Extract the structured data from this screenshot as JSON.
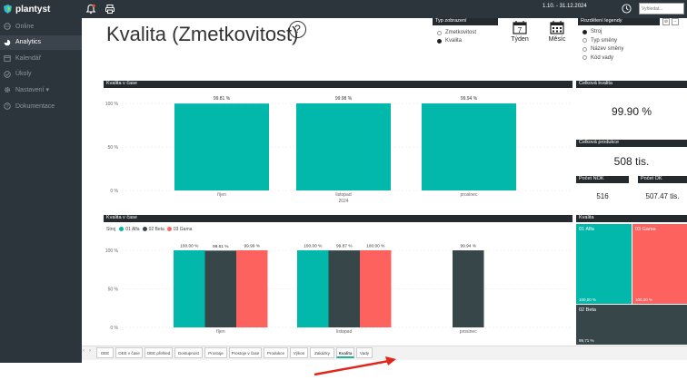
{
  "app": {
    "name": "plantyst"
  },
  "sidebar": {
    "items": [
      {
        "label": "Online",
        "icon": "globe-icon",
        "active": false
      },
      {
        "label": "Analytics",
        "icon": "analytics-icon",
        "active": true
      },
      {
        "label": "Kalendář",
        "icon": "calendar-icon",
        "active": false
      },
      {
        "label": "Úkoly",
        "icon": "check-icon",
        "active": false
      },
      {
        "label": "Nastavení ▾",
        "icon": "gear-icon",
        "active": false
      },
      {
        "label": "Dokumentace",
        "icon": "help-icon",
        "active": false
      }
    ]
  },
  "topbar": {
    "date_range": "1.10. - 31.12.2024",
    "search_placeholder": "Vyhledat..."
  },
  "page": {
    "title": "Kvalita (Zmetkovitost)",
    "help": "?"
  },
  "type_view": {
    "header": "Typ zobrazení",
    "options": [
      "Zmetkovitost",
      "Kvalita"
    ],
    "selected": "Kvalita"
  },
  "period_buttons": {
    "week": "Týden",
    "month": "Měsíc",
    "week_day": "7"
  },
  "legend_split": {
    "header": "Rozdělení legendy",
    "options": [
      "Stroj",
      "Typ směny",
      "Název směny",
      "Kód vady"
    ],
    "selected": "Stroj"
  },
  "cards": {
    "total_quality": {
      "label": "Celková kvalita",
      "value": "99.90 %"
    },
    "total_production": {
      "label": "Celková produkce",
      "value": "508 tis."
    },
    "nok": {
      "label": "Počet NOK",
      "value": "516"
    },
    "ok": {
      "label": "Počet OK",
      "value": "507.47 tis."
    }
  },
  "colors": {
    "teal": "#01b8aa",
    "dark": "#374649",
    "red": "#fd625e",
    "header": "#252a2e",
    "sidebar": "#2d353c"
  },
  "chart_data": [
    {
      "type": "bar",
      "title": "Kvalita v čase",
      "categories": [
        "říjen",
        "listopad",
        "prosinec"
      ],
      "xlabel": "2024",
      "values": [
        99.81,
        99.98,
        99.94
      ],
      "labels": [
        "99.81 %",
        "99.98 %",
        "99.94 %"
      ],
      "ylim": [
        0,
        100
      ],
      "yticks": [
        "100 %",
        "50 %",
        "0 %"
      ]
    },
    {
      "type": "bar",
      "title": "Kvalita v čase",
      "legend_title": "Stroj",
      "categories": [
        "říjen",
        "listopad",
        "prosinec"
      ],
      "series": [
        {
          "name": "01 Alfa",
          "color": "#01b8aa",
          "values": [
            100.0,
            100.0,
            null
          ],
          "labels": [
            "100.00 %",
            "100.00 %",
            ""
          ]
        },
        {
          "name": "02 Beta",
          "color": "#374649",
          "values": [
            99.61,
            99.87,
            99.94
          ],
          "labels": [
            "99.61 %",
            "99.87 %",
            "99.94 %"
          ]
        },
        {
          "name": "03 Gama",
          "color": "#fd625e",
          "values": [
            99.99,
            100.0,
            null
          ],
          "labels": [
            "99.99 %",
            "100.00 %",
            ""
          ]
        }
      ],
      "ylim": [
        0,
        100
      ],
      "yticks": [
        "100 %",
        "50 %",
        "0 %"
      ]
    }
  ],
  "treemap": {
    "title": "Kvalita",
    "cells": [
      {
        "name": "01 Alfa",
        "value": "100,00 %",
        "color": "#01b8aa"
      },
      {
        "name": "03 Gama",
        "value": "100,00 %",
        "color": "#fd625e"
      },
      {
        "name": "02 Beta",
        "value": "99,71 %",
        "color": "#374649"
      }
    ]
  },
  "tabs": [
    "OEE",
    "OEE v čase",
    "OEE přehled",
    "Dostupnost",
    "Prostoje",
    "Prostoje v čase",
    "Produkce",
    "Výkon",
    "Zakázky",
    "Kvalita",
    "Vady"
  ],
  "active_tab": "Kvalita"
}
